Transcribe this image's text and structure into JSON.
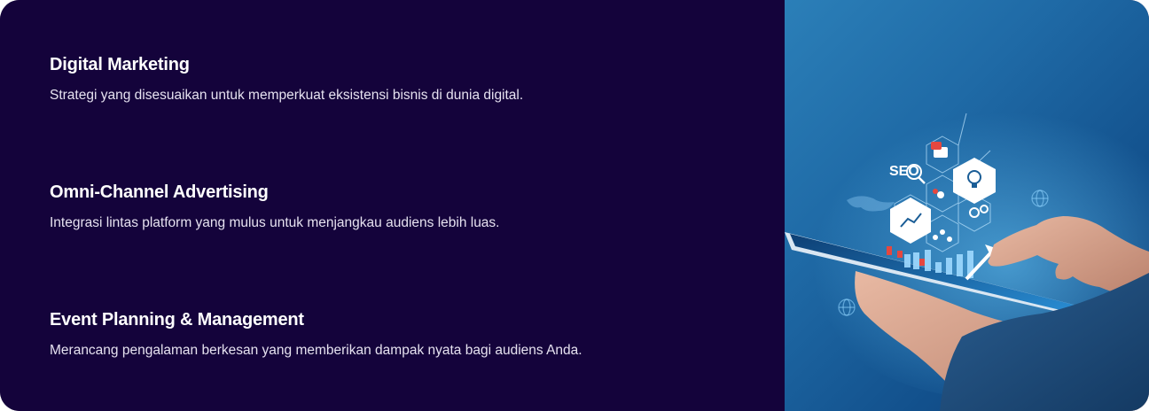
{
  "services": [
    {
      "title": "Digital Marketing",
      "description": "Strategi yang disesuaikan untuk memperkuat eksistensi bisnis di dunia digital."
    },
    {
      "title": "Omni-Channel Advertising",
      "description": "Integrasi lintas platform yang mulus untuk menjangkau audiens lebih luas."
    },
    {
      "title": "Event Planning & Management",
      "description": "Merancang pengalaman berkesan yang memberikan dampak nyata bagi audiens Anda."
    }
  ],
  "illustration": {
    "seo_label": "SEO"
  },
  "colors": {
    "panel_background": "#14033b",
    "text_primary": "#ffffff",
    "image_blue": "#1f6aa6"
  }
}
